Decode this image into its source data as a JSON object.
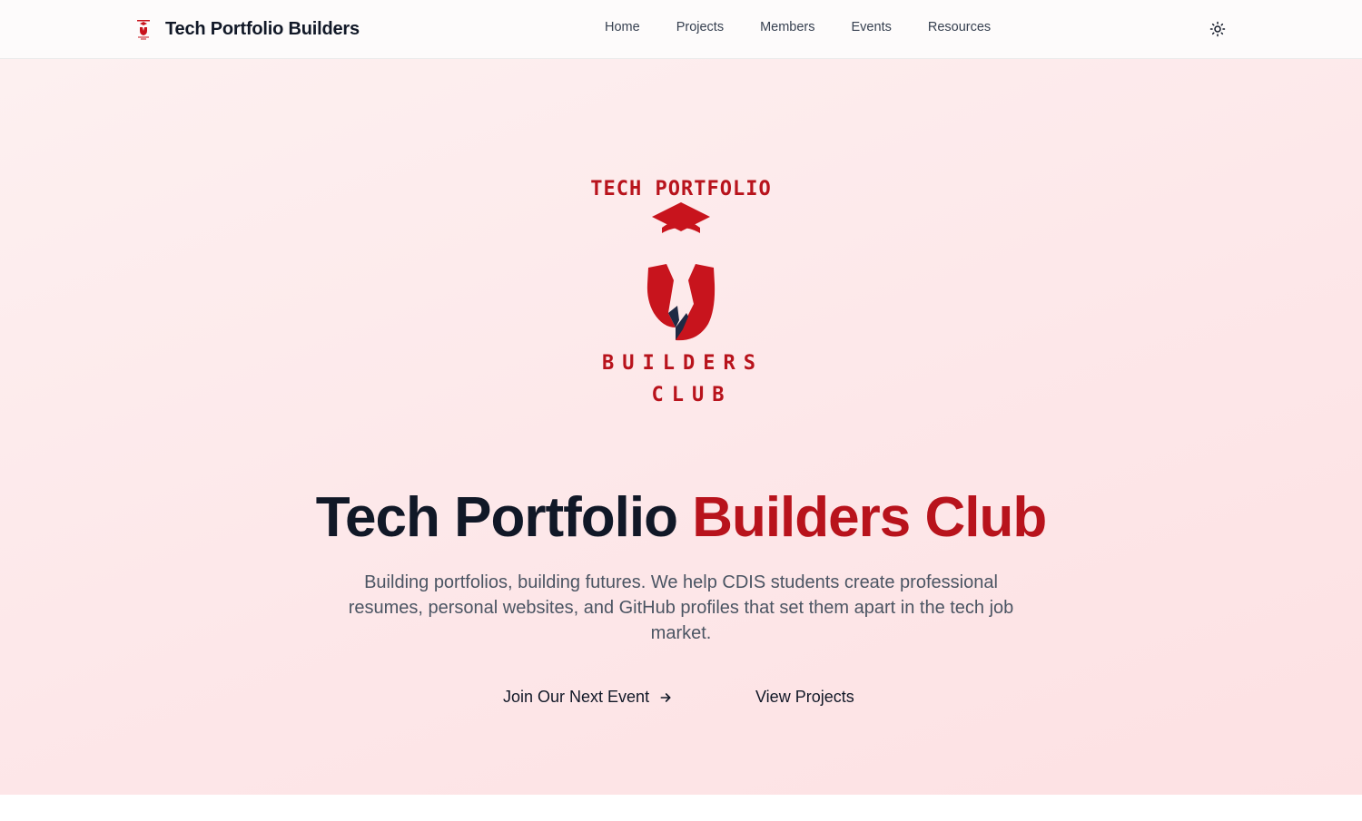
{
  "header": {
    "brand_name": "Tech Portfolio Builders",
    "nav": [
      {
        "label": "Home"
      },
      {
        "label": "Projects"
      },
      {
        "label": "Members"
      },
      {
        "label": "Events"
      },
      {
        "label": "Resources"
      }
    ],
    "theme_toggle_icon": "sun-icon"
  },
  "hero": {
    "logo": {
      "top_text": "TECH PORTFOLIO",
      "middle_text": "BUILDERS",
      "bottom_text": "CLUB"
    },
    "title_main": "Tech Portfolio",
    "title_accent": "Builders Club",
    "subtitle": "Building portfolios, building futures. We help CDIS students create professional resumes, personal websites, and GitHub profiles that set them apart in the tech job market.",
    "cta_primary": "Join Our Next Event",
    "cta_primary_icon": "arrow-right-icon",
    "cta_secondary": "View Projects"
  },
  "colors": {
    "accent": "#b8131c",
    "text_dark": "#111827",
    "text_muted": "#4b5563",
    "hero_bg": "#fde7e9"
  }
}
